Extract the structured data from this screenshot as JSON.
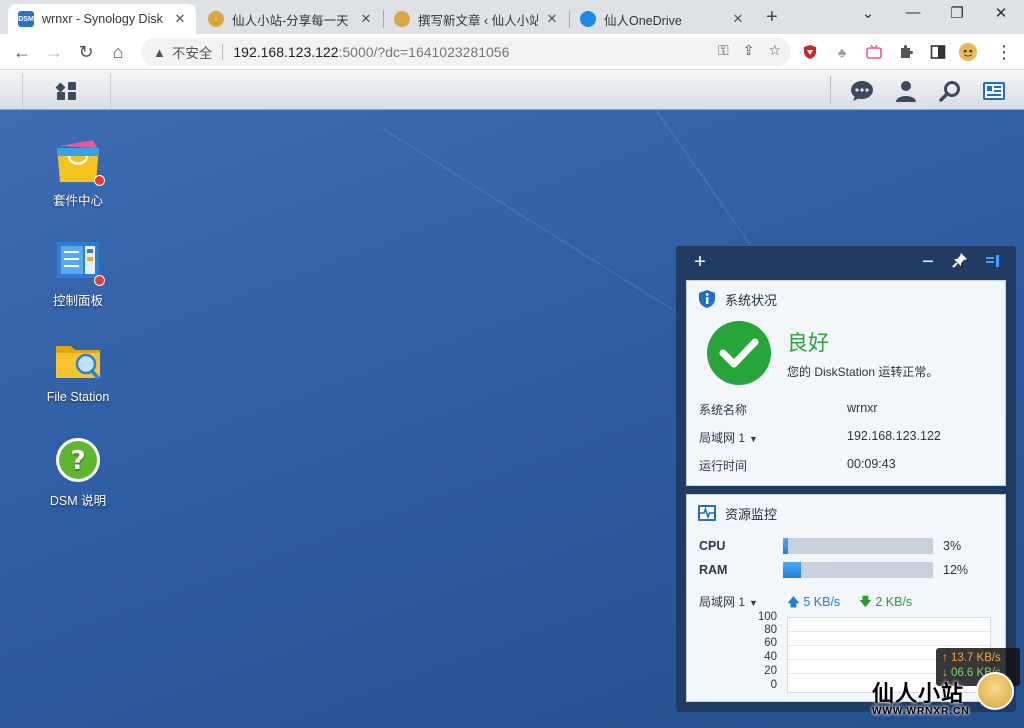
{
  "browser": {
    "tabs": [
      {
        "title": "wrnxr - Synology Disk",
        "favicon_text": "DSM",
        "favicon_color": "#2a6fc9",
        "active": true
      },
      {
        "title": "仙人小站-分享每一天",
        "favicon_color": "#d9a640",
        "active": false
      },
      {
        "title": "撰写新文章 ‹ 仙人小站",
        "favicon_color": "#d9a640",
        "active": false
      },
      {
        "title": "仙人OneDrive",
        "favicon_color": "#1e88e5",
        "active": false
      }
    ],
    "address": {
      "security_label": "不安全",
      "host": "192.168.123.122",
      "path": ":5000/?dc=1641023281056"
    }
  },
  "desktop": {
    "icons": [
      {
        "label": "套件中心",
        "icon": "package-center-icon",
        "has_notification": true
      },
      {
        "label": "控制面板",
        "icon": "control-panel-icon",
        "has_notification": true
      },
      {
        "label": "File Station",
        "icon": "folder-icon",
        "has_notification": false
      },
      {
        "label": "DSM 说明",
        "icon": "help-icon",
        "has_notification": false
      }
    ]
  },
  "widgets": {
    "system_health": {
      "title": "系统状况",
      "status": "良好",
      "description": "您的 DiskStation 运转正常。",
      "rows": [
        {
          "label": "系统名称",
          "value": "wrnxr",
          "dropdown": false
        },
        {
          "label": "局域网 1",
          "value": "192.168.123.122",
          "dropdown": true
        },
        {
          "label": "运行时间",
          "value": "00:09:43",
          "dropdown": false
        }
      ]
    },
    "resource_monitor": {
      "title": "资源监控",
      "cpu_label": "CPU",
      "cpu_percent": 3,
      "cpu_text": "3%",
      "ram_label": "RAM",
      "ram_percent": 12,
      "ram_text": "12%",
      "network_label": "局域网 1",
      "upload": "5 KB/s",
      "download": "2 KB/s",
      "chart_yticks": [
        "100",
        "80",
        "60",
        "40",
        "20",
        "0"
      ]
    }
  },
  "speed_overlay": {
    "up": "↑ 13.7 KB/s",
    "down": "↓ 06.6 KB/s"
  },
  "watermark": {
    "main": "仙人小站",
    "sub": "WWW.WRNXR.CN"
  },
  "colors": {
    "accent": "#1f7fd6",
    "good": "#27a53b",
    "desktop": "#2f5da3"
  }
}
